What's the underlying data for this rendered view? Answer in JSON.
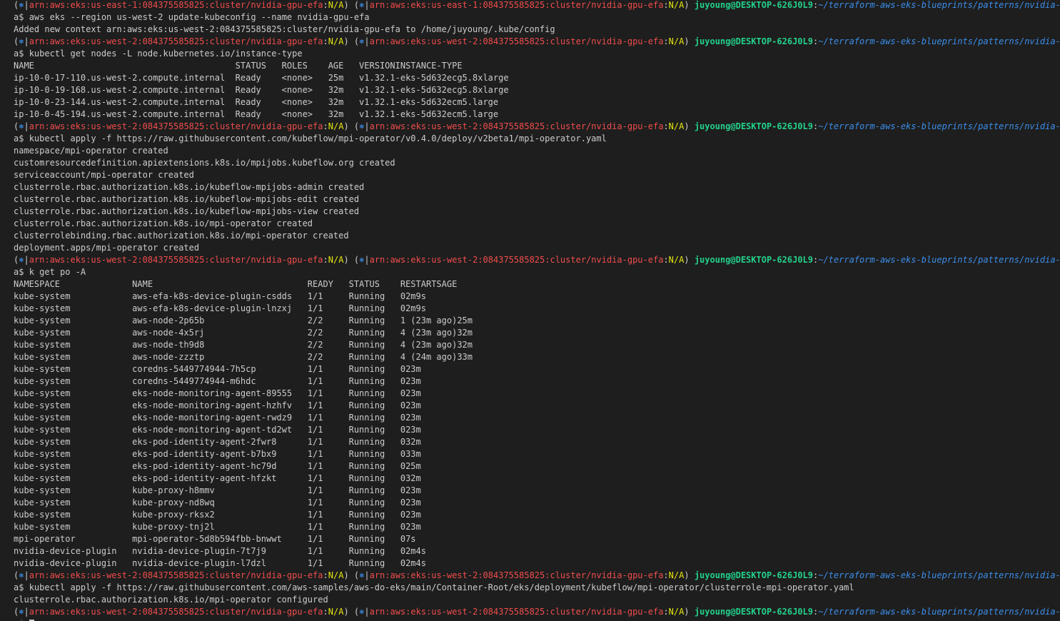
{
  "prompt_style": {
    "colors": {
      "background": "#1e1e1e",
      "text": "#cccccc",
      "context_red": "#f14c4c",
      "na_yellow": "#e5e510",
      "user_green": "#23d18b",
      "path_blue": "#3b8eea"
    }
  },
  "prompts": {
    "east": {
      "open": "(",
      "icon": "⎈",
      "sep": "|",
      "context": "arn:aws:eks:us-east-1:084375585825:cluster/nvidia-gpu-efa",
      "colon": ":",
      "ns": "N/A",
      "close": ")"
    },
    "west": {
      "open": "(",
      "icon": "⎈",
      "sep": "|",
      "context": "arn:aws:eks:us-west-2:084375585825:cluster/nvidia-gpu-efa",
      "colon": ":",
      "ns": "N/A",
      "close": ")"
    },
    "user_host": "juyoung@DESKTOP-626J0L9",
    "path": "~/terraform-aws-eks-blueprints/patterns/nvidia-gpu-ef",
    "cont_char": "a",
    "dollar": "$ "
  },
  "output": {
    "cmd1": "aws eks --region us-west-2 update-kubeconfig --name nvidia-gpu-efa",
    "cmd1_out": "Added new context arn:aws:eks:us-west-2:084375585825:cluster/nvidia-gpu-efa to /home/juyoung/.kube/config",
    "cmd2": "kubectl get nodes -L node.kubernetes.io/instance-type",
    "nodes_header": [
      "NAME",
      "STATUS",
      "ROLES",
      "AGE",
      "VERSION",
      "INSTANCE-TYPE"
    ],
    "nodes": [
      [
        "ip-10-0-17-110.us-west-2.compute.internal",
        "Ready",
        "<none>",
        "25m",
        "v1.32.1-eks-5d632ec",
        "g5.8xlarge"
      ],
      [
        "ip-10-0-19-168.us-west-2.compute.internal",
        "Ready",
        "<none>",
        "32m",
        "v1.32.1-eks-5d632ec",
        "g5.8xlarge"
      ],
      [
        "ip-10-0-23-144.us-west-2.compute.internal",
        "Ready",
        "<none>",
        "32m",
        "v1.32.1-eks-5d632ec",
        "m5.large"
      ],
      [
        "ip-10-0-45-194.us-west-2.compute.internal",
        "Ready",
        "<none>",
        "32m",
        "v1.32.1-eks-5d632ec",
        "m5.large"
      ]
    ],
    "cmd3": "kubectl apply -f https://raw.githubusercontent.com/kubeflow/mpi-operator/v0.4.0/deploy/v2beta1/mpi-operator.yaml",
    "cmd3_out": [
      "namespace/mpi-operator created",
      "customresourcedefinition.apiextensions.k8s.io/mpijobs.kubeflow.org created",
      "serviceaccount/mpi-operator created",
      "clusterrole.rbac.authorization.k8s.io/kubeflow-mpijobs-admin created",
      "clusterrole.rbac.authorization.k8s.io/kubeflow-mpijobs-edit created",
      "clusterrole.rbac.authorization.k8s.io/kubeflow-mpijobs-view created",
      "clusterrole.rbac.authorization.k8s.io/mpi-operator created",
      "clusterrolebinding.rbac.authorization.k8s.io/mpi-operator created",
      "deployment.apps/mpi-operator created"
    ],
    "cmd4": "k get po -A",
    "pods_header": [
      "NAMESPACE",
      "NAME",
      "READY",
      "STATUS",
      "RESTARTS",
      "AGE"
    ],
    "pods": [
      [
        "kube-system",
        "aws-efa-k8s-device-plugin-csdds",
        "1/1",
        "Running",
        "0",
        "2m9s"
      ],
      [
        "kube-system",
        "aws-efa-k8s-device-plugin-lnzxj",
        "1/1",
        "Running",
        "0",
        "2m9s"
      ],
      [
        "kube-system",
        "aws-node-2p65b",
        "2/2",
        "Running",
        "1 (23m ago)",
        "25m"
      ],
      [
        "kube-system",
        "aws-node-4x5rj",
        "2/2",
        "Running",
        "4 (23m ago)",
        "32m"
      ],
      [
        "kube-system",
        "aws-node-th9d8",
        "2/2",
        "Running",
        "4 (23m ago)",
        "32m"
      ],
      [
        "kube-system",
        "aws-node-zzztp",
        "2/2",
        "Running",
        "4 (24m ago)",
        "33m"
      ],
      [
        "kube-system",
        "coredns-5449774944-7h5cp",
        "1/1",
        "Running",
        "0",
        "23m"
      ],
      [
        "kube-system",
        "coredns-5449774944-m6hdc",
        "1/1",
        "Running",
        "0",
        "23m"
      ],
      [
        "kube-system",
        "eks-node-monitoring-agent-89555",
        "1/1",
        "Running",
        "0",
        "23m"
      ],
      [
        "kube-system",
        "eks-node-monitoring-agent-hzhfv",
        "1/1",
        "Running",
        "0",
        "23m"
      ],
      [
        "kube-system",
        "eks-node-monitoring-agent-rwdz9",
        "1/1",
        "Running",
        "0",
        "23m"
      ],
      [
        "kube-system",
        "eks-node-monitoring-agent-td2wt",
        "1/1",
        "Running",
        "0",
        "23m"
      ],
      [
        "kube-system",
        "eks-pod-identity-agent-2fwr8",
        "1/1",
        "Running",
        "0",
        "32m"
      ],
      [
        "kube-system",
        "eks-pod-identity-agent-b7bx9",
        "1/1",
        "Running",
        "0",
        "33m"
      ],
      [
        "kube-system",
        "eks-pod-identity-agent-hc79d",
        "1/1",
        "Running",
        "0",
        "25m"
      ],
      [
        "kube-system",
        "eks-pod-identity-agent-hfzkt",
        "1/1",
        "Running",
        "0",
        "32m"
      ],
      [
        "kube-system",
        "kube-proxy-h8mmv",
        "1/1",
        "Running",
        "0",
        "23m"
      ],
      [
        "kube-system",
        "kube-proxy-nd8wq",
        "1/1",
        "Running",
        "0",
        "23m"
      ],
      [
        "kube-system",
        "kube-proxy-rksx2",
        "1/1",
        "Running",
        "0",
        "23m"
      ],
      [
        "kube-system",
        "kube-proxy-tnj2l",
        "1/1",
        "Running",
        "0",
        "23m"
      ],
      [
        "mpi-operator",
        "mpi-operator-5d8b594fbb-bnwwt",
        "1/1",
        "Running",
        "0",
        "7s"
      ],
      [
        "nvidia-device-plugin",
        "nvidia-device-plugin-7t7j9",
        "1/1",
        "Running",
        "0",
        "2m4s"
      ],
      [
        "nvidia-device-plugin",
        "nvidia-device-plugin-l7dzl",
        "1/1",
        "Running",
        "0",
        "2m4s"
      ]
    ],
    "cmd5": "kubectl apply -f https://raw.githubusercontent.com/aws-samples/aws-do-eks/main/Container-Root/eks/deployment/kubeflow/mpi-operator/clusterrole-mpi-operator.yaml",
    "cmd5_out": "clusterrole.rbac.authorization.k8s.io/mpi-operator configured"
  }
}
